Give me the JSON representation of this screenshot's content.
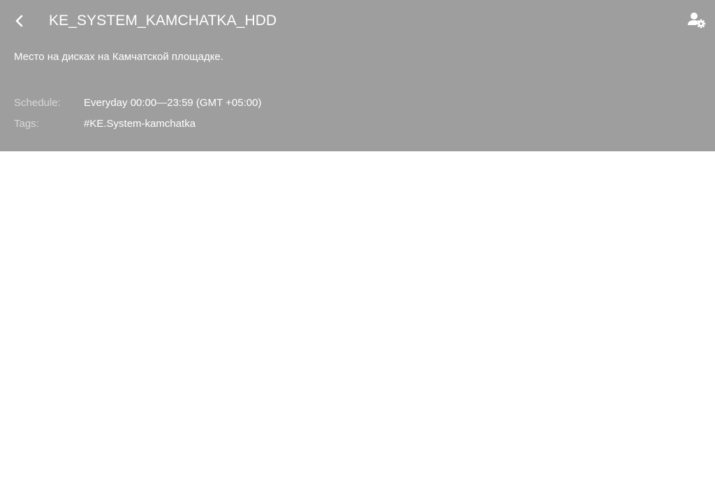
{
  "header": {
    "title": "KE_SYSTEM_KAMCHATKA_HDD",
    "description": "Место на дисках на Камчатской площадке.",
    "back_icon": "chevron-left-icon",
    "settings_icon": "user-settings-icon",
    "background_color": "#9e9e9e"
  },
  "meta": {
    "schedule_label": "Schedule:",
    "schedule_value": "Everyday 00:00—23:59 (GMT +05:00)",
    "tags_label": "Tags:",
    "tags_value": "#KE.System-kamchatka"
  }
}
